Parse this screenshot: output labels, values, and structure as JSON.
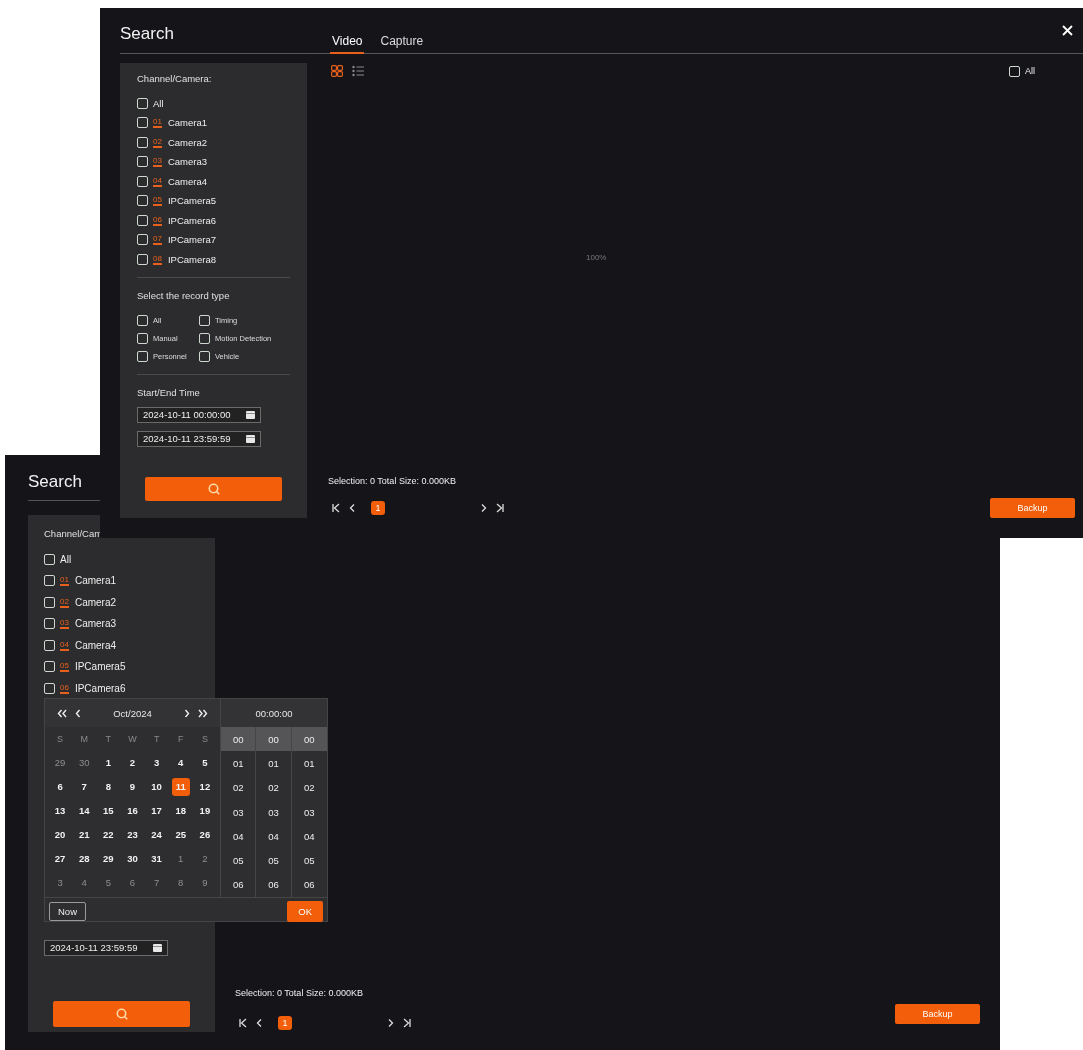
{
  "search_window": {
    "title": "Search",
    "tabs": [
      {
        "label": "Video",
        "selected": true
      },
      {
        "label": "Capture",
        "selected": false
      }
    ],
    "channel_label": "Channel/Camera:",
    "channels": [
      {
        "name": "All",
        "checked": false
      },
      {
        "number": "01",
        "name": "Camera1",
        "checked": false
      },
      {
        "number": "02",
        "name": "Camera2",
        "checked": false
      },
      {
        "number": "03",
        "name": "Camera3",
        "checked": false
      },
      {
        "number": "04",
        "name": "Camera4",
        "checked": false
      },
      {
        "number": "05",
        "name": "IPCamera5",
        "checked": false
      },
      {
        "number": "06",
        "name": "IPCamera6",
        "checked": false
      },
      {
        "number": "07",
        "name": "IPCamera7",
        "checked": false
      },
      {
        "number": "08",
        "name": "IPCamera8",
        "checked": false
      }
    ],
    "record_type_label": "Select the record type",
    "record_types": [
      {
        "label": "All",
        "checked": false
      },
      {
        "label": "Timing",
        "checked": false
      },
      {
        "label": "Manual",
        "checked": false
      },
      {
        "label": "Motion Detection",
        "checked": false
      },
      {
        "label": "Personnel",
        "checked": false
      },
      {
        "label": "Vehicle",
        "checked": false
      }
    ],
    "time_label": "Start/End Time",
    "start_time": "2024-10-11 00:00:00",
    "end_time": "2024-10-11 23:59:59",
    "view_modes": [
      {
        "kind": "grid",
        "selected": true
      },
      {
        "kind": "list",
        "selected": false
      }
    ],
    "select_all": {
      "label": "All",
      "checked": false
    },
    "progress_text": "100%",
    "selection_info": "Selection: 0 Total Size: 0.000KB",
    "pages": [
      {
        "label": "1",
        "selected": true
      }
    ],
    "backup_button": "Backup"
  },
  "background_search_window": {
    "title": "Search",
    "channel_label": "Channel/Cam",
    "channels": [
      {
        "name": "All",
        "checked": false
      },
      {
        "number": "01",
        "name": "Camera1",
        "checked": false
      },
      {
        "number": "02",
        "name": "Camera2",
        "checked": false
      },
      {
        "number": "03",
        "name": "Camera3",
        "checked": false
      },
      {
        "number": "04",
        "name": "Camera4",
        "checked": false
      },
      {
        "number": "05",
        "name": "IPCamera5",
        "checked": false
      },
      {
        "number": "06",
        "name": "IPCamera6",
        "checked": false
      }
    ],
    "date_picker": {
      "month": "Oct/2024",
      "time": "00:00:00",
      "weekdays": [
        "S",
        "M",
        "T",
        "W",
        "T",
        "F",
        "S"
      ],
      "days": [
        {
          "label": "29",
          "muted": true,
          "selected": false
        },
        {
          "label": "30",
          "muted": true,
          "selected": false
        },
        {
          "label": "1",
          "muted": false,
          "selected": false
        },
        {
          "label": "2",
          "muted": false,
          "selected": false
        },
        {
          "label": "3",
          "muted": false,
          "selected": false
        },
        {
          "label": "4",
          "muted": false,
          "selected": false
        },
        {
          "label": "5",
          "muted": false,
          "selected": false
        },
        {
          "label": "6",
          "muted": false,
          "selected": false
        },
        {
          "label": "7",
          "muted": false,
          "selected": false
        },
        {
          "label": "8",
          "muted": false,
          "selected": false
        },
        {
          "label": "9",
          "muted": false,
          "selected": false
        },
        {
          "label": "10",
          "muted": false,
          "selected": false
        },
        {
          "label": "11",
          "muted": false,
          "selected": true
        },
        {
          "label": "12",
          "muted": false,
          "selected": false
        },
        {
          "label": "13",
          "muted": false,
          "selected": false
        },
        {
          "label": "14",
          "muted": false,
          "selected": false
        },
        {
          "label": "15",
          "muted": false,
          "selected": false
        },
        {
          "label": "16",
          "muted": false,
          "selected": false
        },
        {
          "label": "17",
          "muted": false,
          "selected": false
        },
        {
          "label": "18",
          "muted": false,
          "selected": false
        },
        {
          "label": "19",
          "muted": false,
          "selected": false
        },
        {
          "label": "20",
          "muted": false,
          "selected": false
        },
        {
          "label": "21",
          "muted": false,
          "selected": false
        },
        {
          "label": "22",
          "muted": false,
          "selected": false
        },
        {
          "label": "23",
          "muted": false,
          "selected": false
        },
        {
          "label": "24",
          "muted": false,
          "selected": false
        },
        {
          "label": "25",
          "muted": false,
          "selected": false
        },
        {
          "label": "26",
          "muted": false,
          "selected": false
        },
        {
          "label": "27",
          "muted": false,
          "selected": false
        },
        {
          "label": "28",
          "muted": false,
          "selected": false
        },
        {
          "label": "29",
          "muted": false,
          "selected": false
        },
        {
          "label": "30",
          "muted": false,
          "selected": false
        },
        {
          "label": "31",
          "muted": false,
          "selected": false
        },
        {
          "label": "1",
          "muted": true,
          "selected": false
        },
        {
          "label": "2",
          "muted": true,
          "selected": false
        },
        {
          "label": "3",
          "muted": true,
          "selected": false
        },
        {
          "label": "4",
          "muted": true,
          "selected": false
        },
        {
          "label": "5",
          "muted": true,
          "selected": false
        },
        {
          "label": "6",
          "muted": true,
          "selected": false
        },
        {
          "label": "7",
          "muted": true,
          "selected": false
        },
        {
          "label": "8",
          "muted": true,
          "selected": false
        },
        {
          "label": "9",
          "muted": true,
          "selected": false
        }
      ],
      "time_columns": [
        [
          {
            "label": "00",
            "selected": true
          },
          {
            "label": "01",
            "selected": false
          },
          {
            "label": "02",
            "selected": false
          },
          {
            "label": "03",
            "selected": false
          },
          {
            "label": "04",
            "selected": false
          },
          {
            "label": "05",
            "selected": false
          },
          {
            "label": "06",
            "selected": false
          }
        ],
        [
          {
            "label": "00",
            "selected": true
          },
          {
            "label": "01",
            "selected": false
          },
          {
            "label": "02",
            "selected": false
          },
          {
            "label": "03",
            "selected": false
          },
          {
            "label": "04",
            "selected": false
          },
          {
            "label": "05",
            "selected": false
          },
          {
            "label": "06",
            "selected": false
          }
        ],
        [
          {
            "label": "00",
            "selected": true
          },
          {
            "label": "01",
            "selected": false
          },
          {
            "label": "02",
            "selected": false
          },
          {
            "label": "03",
            "selected": false
          },
          {
            "label": "04",
            "selected": false
          },
          {
            "label": "05",
            "selected": false
          },
          {
            "label": "06",
            "selected": false
          }
        ]
      ],
      "now_button": "Now",
      "ok_button": "OK"
    },
    "end_time": "2024-10-11 23:59:59",
    "selection_info": "Selection: 0 Total Size: 0.000KB",
    "pages": [
      {
        "label": "1",
        "selected": true
      }
    ],
    "backup_button": "Backup"
  }
}
